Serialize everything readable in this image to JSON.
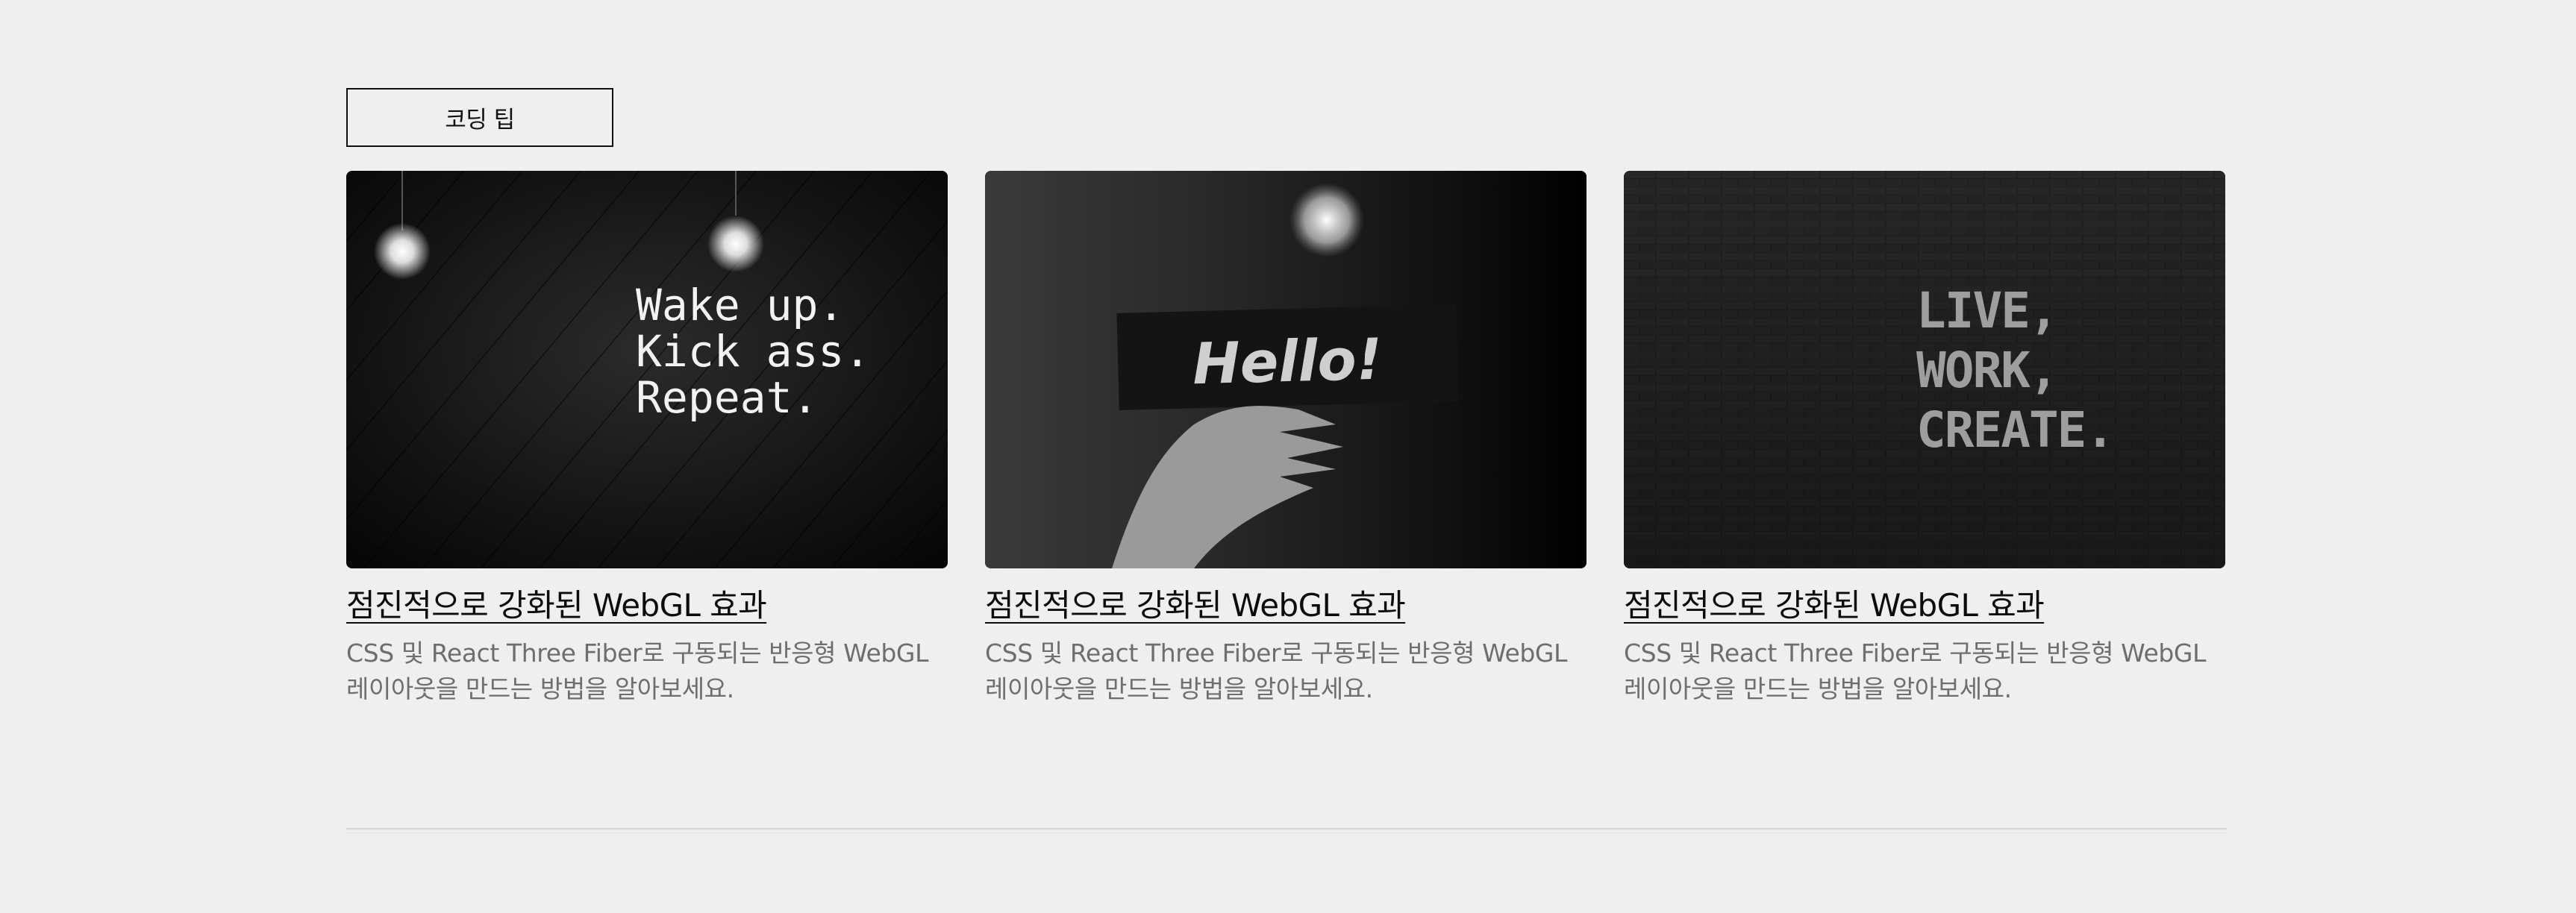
{
  "section_tag": {
    "label": "코딩 팁"
  },
  "cards": [
    {
      "image": {
        "alt_lines": [
          "Wake up.",
          "Kick ass.",
          "Repeat."
        ]
      },
      "title": "점진적으로 강화된 WebGL 효과",
      "description": "CSS 및 React Three Fiber로 구동되는 반응형 WebGL 레이아웃을 만드는 방법을 알아보세요."
    },
    {
      "image": {
        "alt_lines": [
          "Hello!"
        ]
      },
      "title": "점진적으로 강화된 WebGL 효과",
      "description": "CSS 및 React Three Fiber로 구동되는 반응형 WebGL 레이아웃을 만드는 방법을 알아보세요."
    },
    {
      "image": {
        "alt_lines": [
          "LIVE,",
          "WORK,",
          "CREATE."
        ]
      },
      "title": "점진적으로 강화된 WebGL 효과",
      "description": "CSS 및 React Three Fiber로 구동되는 반응형 WebGL 레이아웃을 만드는 방법을 알아보세요."
    }
  ],
  "colors": {
    "background": "#efefef",
    "text": "#111111",
    "muted": "#6e6e6e"
  }
}
